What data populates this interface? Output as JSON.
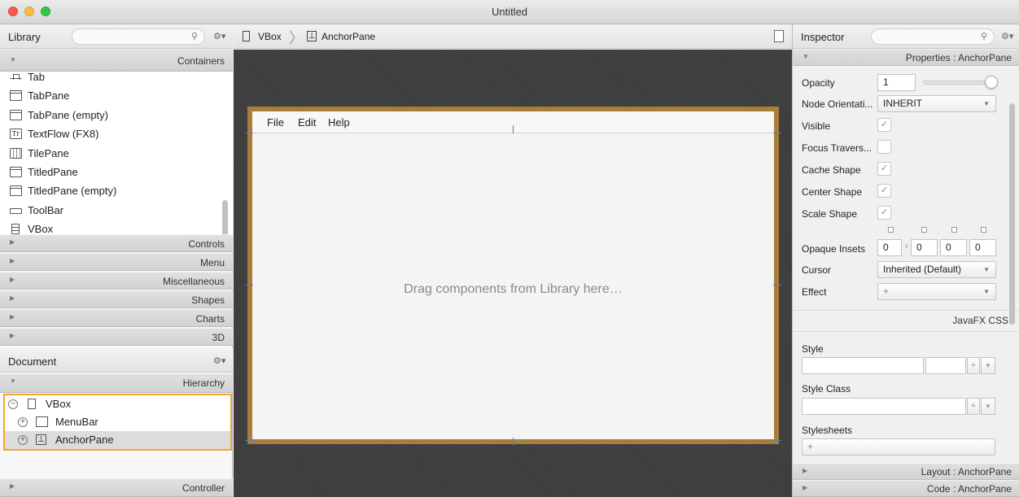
{
  "window": {
    "title": "Untitled"
  },
  "library": {
    "title": "Library",
    "search_placeholder": "",
    "sections": {
      "containers": "Containers",
      "controls": "Controls",
      "menu": "Menu",
      "miscellaneous": "Miscellaneous",
      "shapes": "Shapes",
      "charts": "Charts",
      "three_d": "3D"
    },
    "items": [
      {
        "label": "Tab",
        "icon": "tab-icon"
      },
      {
        "label": "TabPane",
        "icon": "tabpane-icon"
      },
      {
        "label": "TabPane  (empty)",
        "icon": "tabpane-icon"
      },
      {
        "label": "TextFlow  (FX8)",
        "icon": "textflow-icon"
      },
      {
        "label": "TilePane",
        "icon": "tilepane-icon"
      },
      {
        "label": "TitledPane",
        "icon": "titledpane-icon"
      },
      {
        "label": "TitledPane  (empty)",
        "icon": "titledpane-icon"
      },
      {
        "label": "ToolBar",
        "icon": "toolbar-icon"
      },
      {
        "label": "VBox",
        "icon": "vbox-icon"
      }
    ]
  },
  "document": {
    "title": "Document",
    "hierarchy_label": "Hierarchy",
    "controller_label": "Controller",
    "tree": [
      {
        "label": "VBox",
        "disc": "−"
      },
      {
        "label": "MenuBar",
        "disc": "+"
      },
      {
        "label": "AnchorPane",
        "disc": "+"
      }
    ]
  },
  "breadcrumb": {
    "first": "VBox",
    "second": "AnchorPane"
  },
  "canvas": {
    "menus": [
      "File",
      "Edit",
      "Help"
    ],
    "placeholder": "Drag components from Library here…"
  },
  "inspector": {
    "title": "Inspector",
    "properties_header": "Properties : AnchorPane",
    "layout_header": "Layout : AnchorPane",
    "code_header": "Code : AnchorPane",
    "javafx_css": "JavaFX CSS",
    "opacity": {
      "label": "Opacity",
      "value": "1",
      "slider_fraction": 1.0
    },
    "node_orientation": {
      "label": "Node Orientati...",
      "value": "INHERIT"
    },
    "visible": {
      "label": "Visible",
      "checked": true
    },
    "focus_traversable": {
      "label": "Focus Travers...",
      "checked": false
    },
    "cache_shape": {
      "label": "Cache Shape",
      "checked": true
    },
    "center_shape": {
      "label": "Center Shape",
      "checked": true
    },
    "scale_shape": {
      "label": "Scale Shape",
      "checked": true
    },
    "opaque_insets": {
      "label": "Opaque Insets",
      "values": [
        "0",
        "0",
        "0",
        "0"
      ]
    },
    "cursor": {
      "label": "Cursor",
      "value": "Inherited (Default)"
    },
    "effect": {
      "label": "Effect",
      "value": "+"
    },
    "style_label": "Style",
    "style_class_label": "Style Class",
    "stylesheets_label": "Stylesheets",
    "stylesheets_add": "+",
    "check_glyph": "✓"
  },
  "colors": {
    "selection_border": "#f0a630",
    "canvas_frame": "#a77e3c",
    "stage_bg": "#3c3c3c"
  }
}
